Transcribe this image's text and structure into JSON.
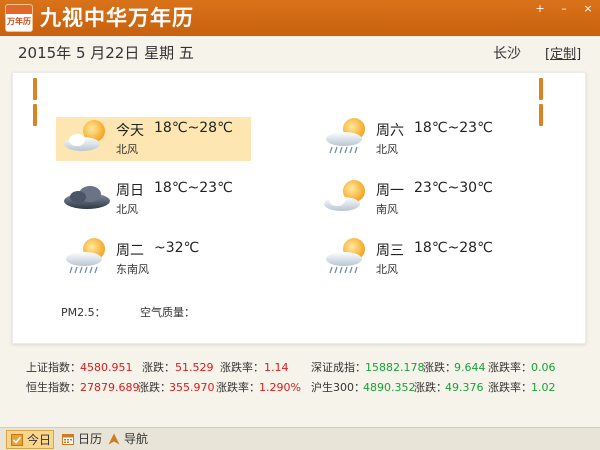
{
  "app": {
    "title": "九视中华万年历",
    "logo_text": "万年历"
  },
  "window_controls": [
    "+",
    "–",
    "×"
  ],
  "header": {
    "date": "2015年 5 月22日 星期 五",
    "city": "长沙",
    "custom": "[定制]"
  },
  "forecast": [
    {
      "day": "今天",
      "temp": "18℃~28℃",
      "wind": "北风",
      "icon": "sunny-cloudy-icon",
      "highlight": true
    },
    {
      "day": "周六",
      "temp": "18℃~23℃",
      "wind": "北风",
      "icon": "sun-rain-icon",
      "highlight": false
    },
    {
      "day": "周日",
      "temp": "18℃~23℃",
      "wind": "北风",
      "icon": "dark-cloud-icon",
      "highlight": false
    },
    {
      "day": "周一",
      "temp": "23℃~30℃",
      "wind": "南风",
      "icon": "sunny-cloudy-icon",
      "highlight": false
    },
    {
      "day": "周二",
      "temp": "~32℃",
      "wind": "东南风",
      "icon": "sun-rain-icon",
      "highlight": false
    },
    {
      "day": "周三",
      "temp": "18℃~28℃",
      "wind": "北风",
      "icon": "sun-rain-icon",
      "highlight": false
    }
  ],
  "air": {
    "pm_label": "PM2.5：",
    "aq_label": "空气质量："
  },
  "stocks": {
    "row1": [
      {
        "name": "上证指数：",
        "value": "4580.951",
        "chg_label": "涨跌：",
        "chg": "51.529",
        "pct_label": "涨跌率：",
        "pct": "1.14",
        "color": "red"
      },
      {
        "name": "深证成指：",
        "value": "15882.178",
        "chg_label": "涨跌：",
        "chg": "9.644",
        "pct_label": "涨跌率：",
        "pct": "0.06",
        "color": "green"
      }
    ],
    "row2": [
      {
        "name": "恒生指数：",
        "value": "27879.689",
        "chg_label": "涨跌：",
        "chg": "355.970",
        "pct_label": "涨跌率：",
        "pct": "1.290%",
        "color": "red"
      },
      {
        "name": "沪生300：",
        "value": "4890.352",
        "chg_label": "涨跌：",
        "chg": "49.376",
        "pct_label": "涨跌率：",
        "pct": "1.02",
        "color": "green"
      }
    ]
  },
  "footer_tabs": [
    {
      "label": "今日",
      "active": true
    },
    {
      "label": "日历",
      "active": false
    },
    {
      "label": "导航",
      "active": false
    }
  ],
  "colors": {
    "accent": "#c8600d",
    "today_highlight": "#fde6b2",
    "up": "#d91c1c",
    "down": "#18a338"
  }
}
